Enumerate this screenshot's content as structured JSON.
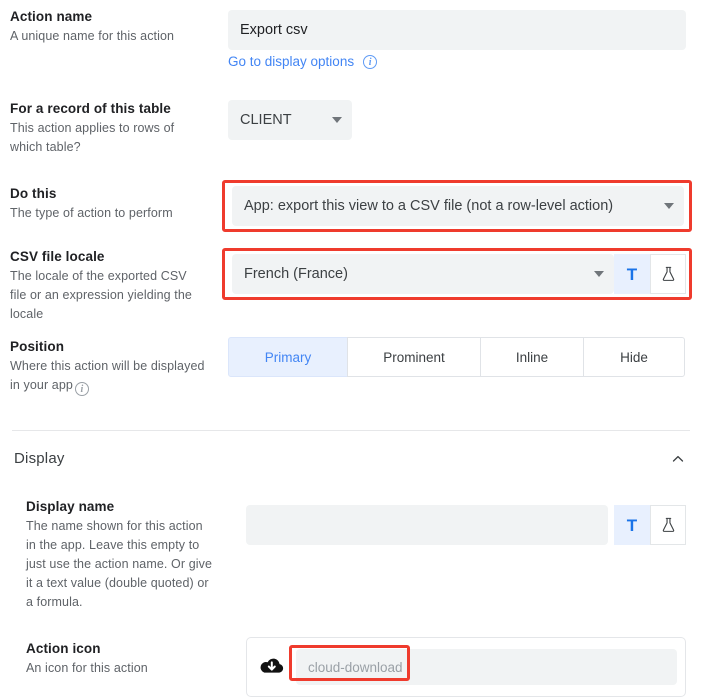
{
  "fields": {
    "action_name": {
      "title": "Action name",
      "desc": "A unique name for this action",
      "value": "Export csv",
      "link_text": "Go to display options"
    },
    "record_table": {
      "title": "For a record of this table",
      "desc": "This action applies to rows of which table?",
      "value": "CLIENT"
    },
    "do_this": {
      "title": "Do this",
      "desc": "The type of action to perform",
      "value": "App: export this view to a CSV file (not a row-level action)"
    },
    "csv_locale": {
      "title": "CSV file locale",
      "desc": "The locale of the exported CSV file or an expression yielding the locale",
      "value": "French (France)"
    },
    "position": {
      "title": "Position",
      "desc": "Where this action will be displayed in your app",
      "options": [
        "Primary",
        "Prominent",
        "Inline",
        "Hide"
      ],
      "selected": "Primary"
    },
    "display_name": {
      "title": "Display name",
      "desc": "The name shown for this action in the app. Leave this empty to just use the action name. Or give it a text value (double quoted) or a formula.",
      "value": ""
    },
    "action_icon": {
      "title": "Action icon",
      "desc": "An icon for this action",
      "value": "cloud-download"
    }
  },
  "display_section": {
    "title": "Display"
  },
  "toggles": {
    "text_mode_label": "T",
    "formula_mode_label": "formula-flask-icon"
  },
  "colors": {
    "accent": "#4285f4",
    "highlight": "#ef3b2d",
    "field_bg": "#f1f3f4",
    "selected_tab_bg": "#e8f0fe",
    "label_text": "#202124",
    "desc_text": "#5f6368"
  }
}
